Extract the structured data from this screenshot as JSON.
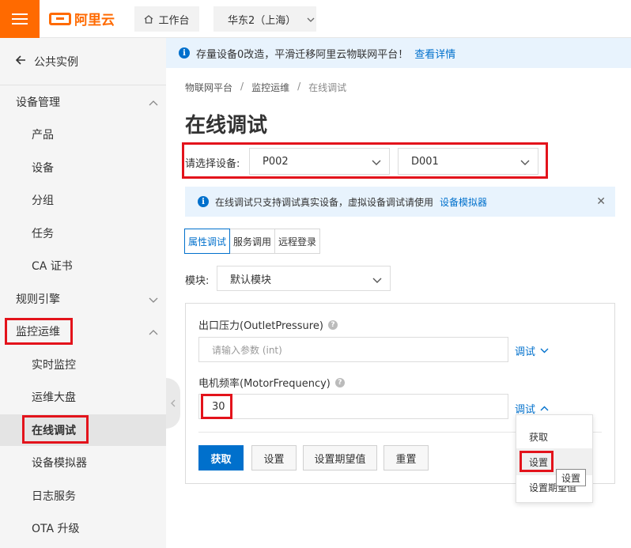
{
  "topbar": {
    "logo_text": "阿里云",
    "workbench_label": "工作台",
    "region_label": "华东2（上海）"
  },
  "sidebar": {
    "back_label": "公共实例",
    "groups": [
      {
        "label": "设备管理",
        "expanded": true,
        "items": [
          "产品",
          "设备",
          "分组",
          "任务",
          "CA 证书"
        ]
      },
      {
        "label": "规则引擎",
        "expanded": false,
        "items": []
      },
      {
        "label": "监控运维",
        "expanded": true,
        "items": [
          "实时监控",
          "运维大盘",
          "在线调试",
          "设备模拟器",
          "日志服务",
          "OTA 升级"
        ]
      }
    ],
    "active_item": "在线调试"
  },
  "notice": {
    "text": "存量设备0改造，平滑迁移阿里云物联网平台！",
    "link": "查看详情"
  },
  "breadcrumb": [
    "物联网平台",
    "监控运维",
    "在线调试"
  ],
  "page_title": "在线调试",
  "device_select": {
    "label": "请选择设备:",
    "product_value": "P002",
    "device_value": "D001"
  },
  "tip": {
    "text": "在线调试只支持调试真实设备，虚拟设备调试请使用",
    "link": "设备模拟器"
  },
  "tabs": [
    "属性调试",
    "服务调用",
    "远程登录"
  ],
  "active_tab": "属性调试",
  "module": {
    "label": "模块:",
    "value": "默认模块"
  },
  "properties": [
    {
      "label": "出口压力(OutletPressure)",
      "value": "",
      "placeholder": "请输入参数 (int)",
      "debug_label": "调试",
      "expanded": false
    },
    {
      "label": "电机频率(MotorFrequency)",
      "value": "30",
      "placeholder": "",
      "debug_label": "调试",
      "expanded": true
    }
  ],
  "actions": [
    "获取",
    "设置",
    "设置期望值",
    "重置"
  ],
  "dropdown": {
    "items": [
      "获取",
      "设置",
      "设置期望值"
    ],
    "hovered": "设置"
  },
  "tooltip_text": "设置",
  "colors": {
    "brand_orange": "#ff6a00",
    "primary_blue": "#0070cc",
    "highlight_red": "#e3131b"
  }
}
